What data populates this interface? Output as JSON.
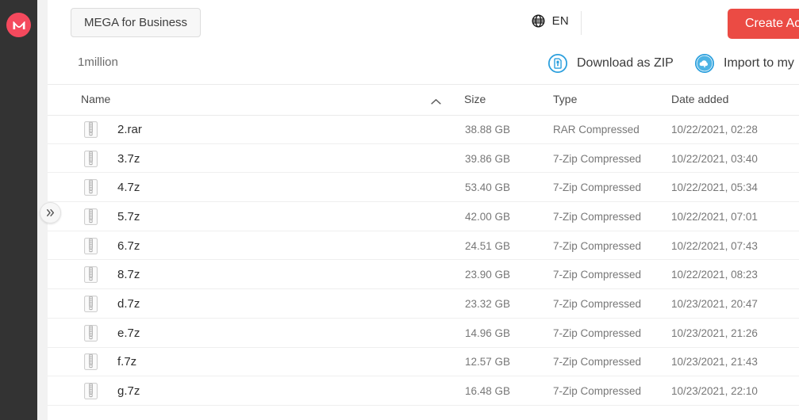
{
  "brand": {
    "logo_letter": "M",
    "logo_color": "#f4495d",
    "accent_red": "#eb4b44",
    "accent_blue": "#2b9fdd"
  },
  "sidebar": {
    "logo_icon": "mega-logo-icon",
    "expand_icon": "double-chevron-right-icon"
  },
  "topbar": {
    "business_button": "MEGA for Business",
    "language_icon": "globe-icon",
    "language": "EN",
    "create_account_button": "Create Acc"
  },
  "subbar": {
    "breadcrumb": "1million",
    "download_zip_icon": "download-zip-icon",
    "download_zip_label": "Download as ZIP",
    "import_icon": "cloud-upload-icon",
    "import_label": "Import to my"
  },
  "table": {
    "columns": {
      "name": "Name",
      "size": "Size",
      "type": "Type",
      "date": "Date added"
    },
    "sort": {
      "column": "Name",
      "direction": "asc",
      "icon": "chevron-up-icon"
    },
    "rows": [
      {
        "icon": "archive-file-icon",
        "name": "2.rar",
        "size": "38.88 GB",
        "type": "RAR Compressed",
        "date": "10/22/2021, 02:28"
      },
      {
        "icon": "archive-file-icon",
        "name": "3.7z",
        "size": "39.86 GB",
        "type": "7-Zip Compressed",
        "date": "10/22/2021, 03:40"
      },
      {
        "icon": "archive-file-icon",
        "name": "4.7z",
        "size": "53.40 GB",
        "type": "7-Zip Compressed",
        "date": "10/22/2021, 05:34"
      },
      {
        "icon": "archive-file-icon",
        "name": "5.7z",
        "size": "42.00 GB",
        "type": "7-Zip Compressed",
        "date": "10/22/2021, 07:01"
      },
      {
        "icon": "archive-file-icon",
        "name": "6.7z",
        "size": "24.51 GB",
        "type": "7-Zip Compressed",
        "date": "10/22/2021, 07:43"
      },
      {
        "icon": "archive-file-icon",
        "name": "8.7z",
        "size": "23.90 GB",
        "type": "7-Zip Compressed",
        "date": "10/22/2021, 08:23"
      },
      {
        "icon": "archive-file-icon",
        "name": "d.7z",
        "size": "23.32 GB",
        "type": "7-Zip Compressed",
        "date": "10/23/2021, 20:47"
      },
      {
        "icon": "archive-file-icon",
        "name": "e.7z",
        "size": "14.96 GB",
        "type": "7-Zip Compressed",
        "date": "10/23/2021, 21:26"
      },
      {
        "icon": "archive-file-icon",
        "name": "f.7z",
        "size": "12.57 GB",
        "type": "7-Zip Compressed",
        "date": "10/23/2021, 21:43"
      },
      {
        "icon": "archive-file-icon",
        "name": "g.7z",
        "size": "16.48 GB",
        "type": "7-Zip Compressed",
        "date": "10/23/2021, 22:10"
      }
    ]
  }
}
